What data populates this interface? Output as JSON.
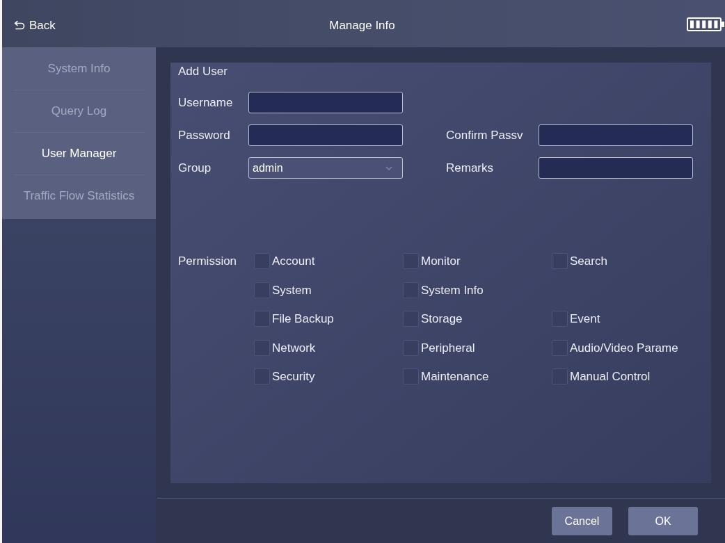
{
  "top_bar": {
    "back_label": "Back",
    "title": "Manage Info"
  },
  "sidebar": {
    "items": [
      {
        "label": "System Info",
        "selected": false
      },
      {
        "label": "Query Log",
        "selected": false
      },
      {
        "label": "User Manager",
        "selected": true
      },
      {
        "label": "Traffic Flow Statistics",
        "selected": false
      }
    ]
  },
  "form": {
    "title": "Add User",
    "rows": [
      [
        {
          "label": "Username",
          "kind": "input"
        }
      ],
      [
        {
          "label": "Password",
          "kind": "input"
        },
        {
          "label": "Confirm Passv",
          "kind": "input"
        }
      ],
      [
        {
          "label": "Group",
          "kind": "select",
          "value": "admin"
        },
        {
          "label": "Remarks",
          "kind": "input"
        }
      ]
    ]
  },
  "permissions": {
    "label": "Permission",
    "rows": [
      [
        {
          "label": "Account",
          "checked": false
        },
        {
          "label": "Monitor",
          "checked": false
        },
        {
          "label": "Search",
          "checked": false
        }
      ],
      [
        {
          "label": "System",
          "checked": false
        },
        {
          "label": "System Info",
          "checked": false
        }
      ],
      [
        {
          "label": "File Backup",
          "checked": false
        },
        {
          "label": "Storage",
          "checked": false
        },
        {
          "label": "Event",
          "checked": false
        }
      ],
      [
        {
          "label": "Network",
          "checked": false
        },
        {
          "label": "Peripheral",
          "checked": false
        },
        {
          "label": "Audio/Video Parame",
          "checked": false
        }
      ],
      [
        {
          "label": "Security",
          "checked": false
        },
        {
          "label": "Maintenance",
          "checked": false
        },
        {
          "label": "Manual Control",
          "checked": false
        }
      ]
    ]
  },
  "buttons": [
    {
      "label": "Cancel"
    },
    {
      "label": "OK"
    }
  ]
}
